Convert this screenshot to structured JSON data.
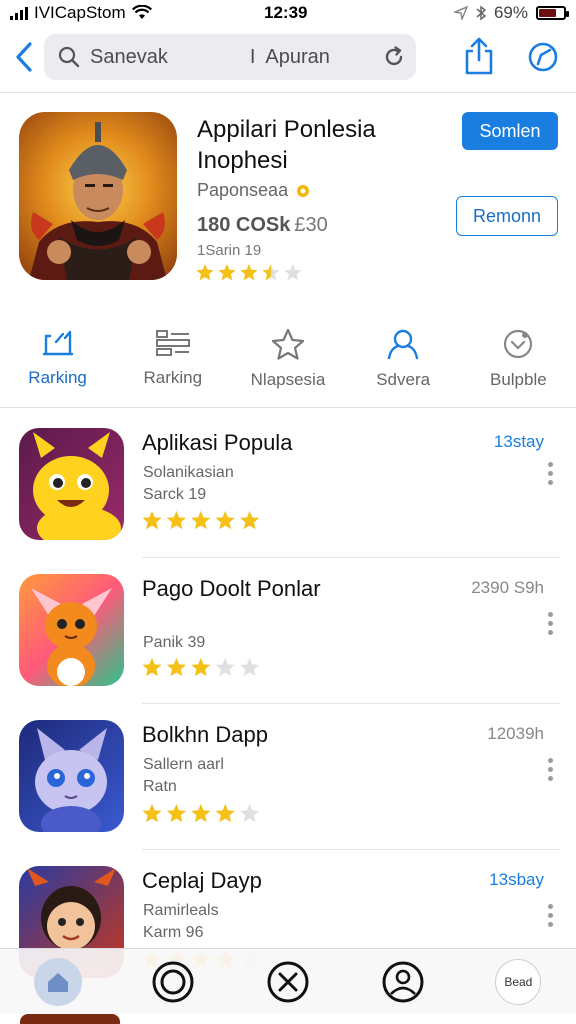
{
  "status_bar": {
    "carrier": "IVICapStom",
    "time": "12:39",
    "battery": "69%",
    "battery_level": 0.69
  },
  "search": {
    "left_text": "Sanevak",
    "separator": "I",
    "right_text": "Apuran"
  },
  "featured": {
    "title": "Appilari Ponlesia Inophesi",
    "developer": "Paponseaa",
    "price": "180 COSk",
    "price_extra": "£30",
    "size": "1Sarin 19",
    "rating": 3.5,
    "primary_button": "Somlen",
    "secondary_button": "Remonn"
  },
  "tabs": [
    {
      "label": "Rarking",
      "icon": "ranking-icon",
      "active": true
    },
    {
      "label": "Rarking",
      "icon": "grid-list-icon",
      "active": false
    },
    {
      "label": "Nlapsesia",
      "icon": "star-icon",
      "active": false
    },
    {
      "label": "Sdvera",
      "icon": "person-icon",
      "active": false
    },
    {
      "label": "Bulpble",
      "icon": "badge-icon",
      "active": false
    }
  ],
  "list": [
    {
      "title": "Aplikasi Popula",
      "line1": "Solanikasian",
      "line2": "Sarck 19",
      "time": "13stay",
      "time_blue": true,
      "rating": 5
    },
    {
      "title": "Pago Doolt Ponlar",
      "line1": "",
      "line2": "Panik 39",
      "time": "2390 S9h",
      "time_blue": false,
      "rating": 3
    },
    {
      "title": "Bolkhn Dapp",
      "line1": "Sallern aarl",
      "line2": "Ratn",
      "time": "12039h",
      "time_blue": false,
      "rating": 4
    },
    {
      "title": "Ceplaj Dayp",
      "line1": "Ramirleals",
      "line2": "Karm 96",
      "time": "13sbay",
      "time_blue": true,
      "rating": 4
    }
  ],
  "bottom_nav": {
    "more_label": "Bead"
  },
  "colors": {
    "accent": "#1a7de0",
    "star": "#f5c116",
    "star_empty": "#e0e0e0"
  }
}
